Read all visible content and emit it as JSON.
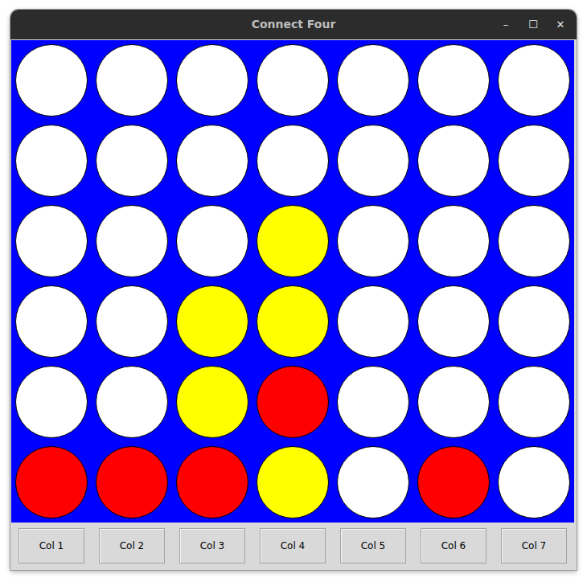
{
  "window": {
    "title": "Connect Four",
    "controls": [
      "–",
      "☐",
      "✕"
    ]
  },
  "board": {
    "rows": [
      [
        {
          "color": "#ffffff"
        },
        {
          "color": "#ffffff"
        },
        {
          "color": "#ffffff"
        },
        {
          "color": "#ffffff"
        },
        {
          "color": "#ffffff"
        },
        {
          "color": "#ffffff"
        },
        {
          "color": "#ffffff"
        }
      ],
      [
        {
          "color": "#ffffff"
        },
        {
          "color": "#ffffff"
        },
        {
          "color": "#ffffff"
        },
        {
          "color": "#ffffff"
        },
        {
          "color": "#ffffff"
        },
        {
          "color": "#ffffff"
        },
        {
          "color": "#ffffff"
        }
      ],
      [
        {
          "color": "#ffffff"
        },
        {
          "color": "#ffffff"
        },
        {
          "color": "#ffffff"
        },
        {
          "color": "#ffff00"
        },
        {
          "color": "#ffffff"
        },
        {
          "color": "#ffffff"
        },
        {
          "color": "#ffffff"
        }
      ],
      [
        {
          "color": "#ffffff"
        },
        {
          "color": "#ffffff"
        },
        {
          "color": "#ffff00"
        },
        {
          "color": "#ffff00"
        },
        {
          "color": "#ffffff"
        },
        {
          "color": "#ffffff"
        },
        {
          "color": "#ffffff"
        }
      ],
      [
        {
          "color": "#ffffff"
        },
        {
          "color": "#ffffff"
        },
        {
          "color": "#ffff00"
        },
        {
          "color": "#ff0000"
        },
        {
          "color": "#ffffff"
        },
        {
          "color": "#ffffff"
        },
        {
          "color": "#ffffff"
        }
      ],
      [
        {
          "color": "#ff0000"
        },
        {
          "color": "#ff0000"
        },
        {
          "color": "#ff0000"
        },
        {
          "color": "#ffff00"
        },
        {
          "color": "#ffffff"
        },
        {
          "color": "#ff0000"
        },
        {
          "color": "#ffffff"
        }
      ]
    ]
  },
  "buttons": [
    "Col 1",
    "Col 2",
    "Col 3",
    "Col 4",
    "Col 5",
    "Col 6",
    "Col 7"
  ]
}
